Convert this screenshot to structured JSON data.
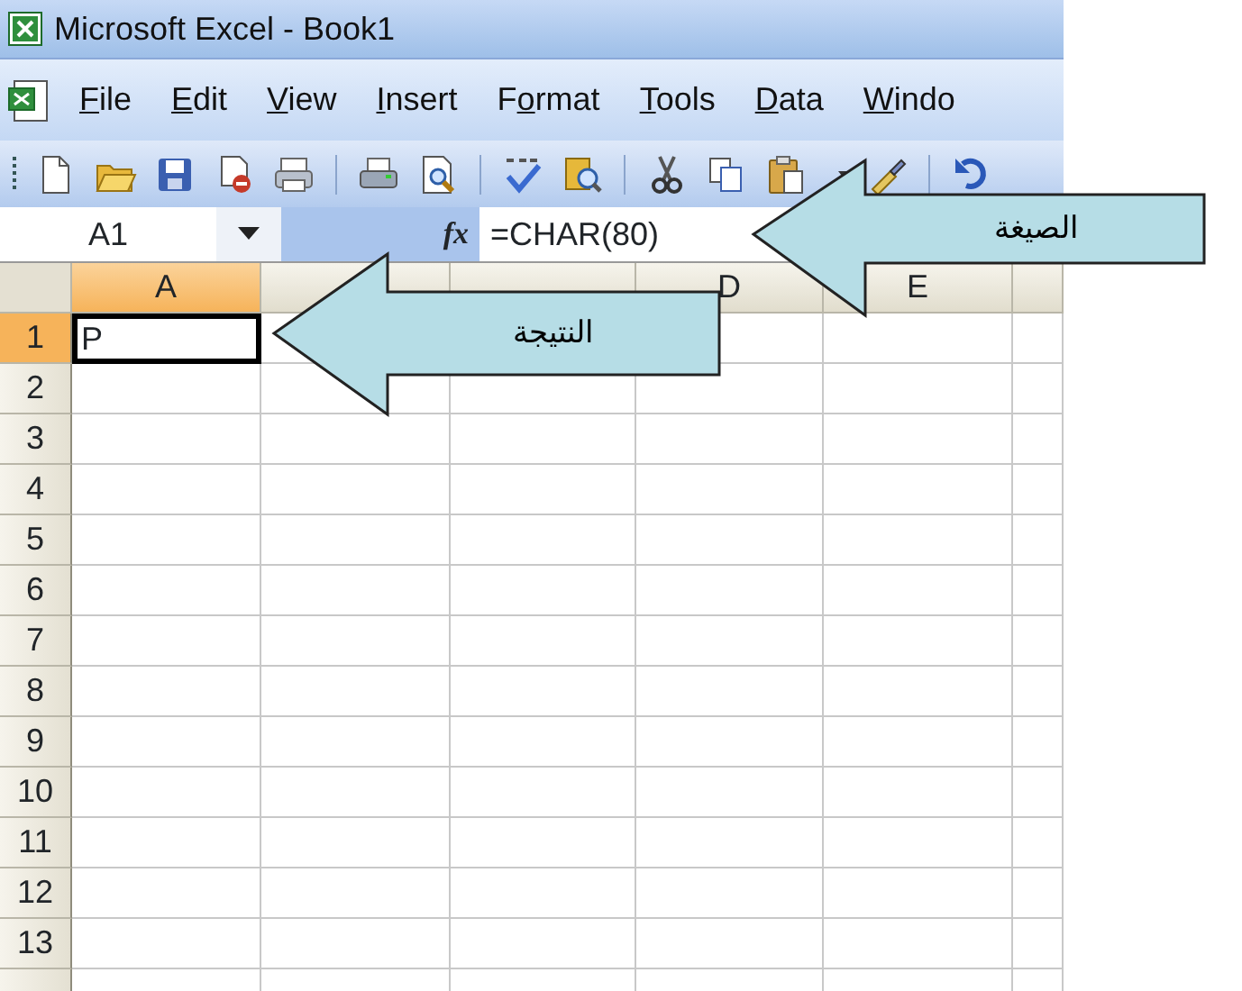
{
  "window": {
    "title": "Microsoft Excel - Book1"
  },
  "menu": [
    {
      "mnemonic": "F",
      "rest": "ile"
    },
    {
      "mnemonic": "E",
      "rest": "dit"
    },
    {
      "mnemonic": "V",
      "rest": "iew"
    },
    {
      "mnemonic": "I",
      "rest": "nsert"
    },
    {
      "before": "F",
      "mnemonic": "o",
      "rest": "rmat"
    },
    {
      "mnemonic": "T",
      "rest": "ools"
    },
    {
      "mnemonic": "D",
      "rest": "ata"
    },
    {
      "mnemonic": "W",
      "rest": "indo"
    }
  ],
  "toolbar": [
    {
      "kind": "new"
    },
    {
      "kind": "open"
    },
    {
      "kind": "save"
    },
    {
      "kind": "permission"
    },
    {
      "kind": "email"
    },
    {
      "kind": "sep"
    },
    {
      "kind": "print"
    },
    {
      "kind": "preview"
    },
    {
      "kind": "sep"
    },
    {
      "kind": "spelling"
    },
    {
      "kind": "research"
    },
    {
      "kind": "sep"
    },
    {
      "kind": "cut"
    },
    {
      "kind": "copy"
    },
    {
      "kind": "paste"
    },
    {
      "kind": "dropdown"
    },
    {
      "kind": "painter"
    },
    {
      "kind": "sep"
    },
    {
      "kind": "undo"
    }
  ],
  "formula_bar": {
    "name_box": "A1",
    "function_label": "fx",
    "formula": "=CHAR(80)"
  },
  "columns": [
    {
      "label": "A",
      "selected": true
    },
    {
      "selected": false
    },
    {
      "selected": false
    },
    {
      "label": "D",
      "selected": false
    },
    {
      "label": "E",
      "selected": false
    },
    {
      "selected": false
    }
  ],
  "rows": [
    {
      "label": "1",
      "selected": true,
      "cells": [
        "P"
      ]
    },
    {
      "label": "2",
      "selected": false
    },
    {
      "label": "3",
      "selected": false
    },
    {
      "label": "4",
      "selected": false
    },
    {
      "label": "5",
      "selected": false
    },
    {
      "label": "6",
      "selected": false
    },
    {
      "label": "7",
      "selected": false
    },
    {
      "label": "8",
      "selected": false
    },
    {
      "label": "9",
      "selected": false
    },
    {
      "label": "10",
      "selected": false
    },
    {
      "label": "11",
      "selected": false
    },
    {
      "label": "12",
      "selected": false
    },
    {
      "label": "13",
      "selected": false
    },
    {
      "selected": false
    }
  ],
  "callouts": [
    {
      "text": "الصيغة"
    },
    {
      "text": "النتيجة"
    }
  ]
}
